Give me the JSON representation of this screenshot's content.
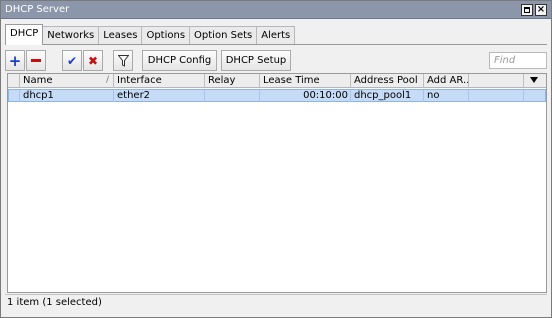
{
  "window": {
    "title": "DHCP Server",
    "restore_label": "",
    "close_label": "×"
  },
  "tabs": [
    {
      "label": "DHCP",
      "active": true
    },
    {
      "label": "Networks",
      "active": false
    },
    {
      "label": "Leases",
      "active": false
    },
    {
      "label": "Options",
      "active": false
    },
    {
      "label": "Option Sets",
      "active": false
    },
    {
      "label": "Alerts",
      "active": false
    }
  ],
  "toolbar": {
    "add_icon": "plus-icon",
    "remove_icon": "minus-icon",
    "enable_icon": "check-icon",
    "disable_icon": "cross-icon",
    "filter_icon": "filter-icon",
    "dhcp_config_label": "DHCP Config",
    "dhcp_setup_label": "DHCP Setup",
    "find_placeholder": "Find"
  },
  "table": {
    "columns": [
      "Name",
      "Interface",
      "Relay",
      "Lease Time",
      "Address Pool",
      "Add AR..."
    ],
    "sort_indicator": "/",
    "rows": [
      {
        "name": "dhcp1",
        "interface": "ether2",
        "relay": "",
        "lease_time": "00:10:00",
        "address_pool": "dhcp_pool1",
        "add_arp": "no",
        "selected": true
      }
    ]
  },
  "status": {
    "text": "1 item (1 selected)"
  },
  "colors": {
    "titlebar": "#8c96ab",
    "selection": "#c6dbf5",
    "add": "#1a3cc9",
    "remove": "#c41010"
  }
}
